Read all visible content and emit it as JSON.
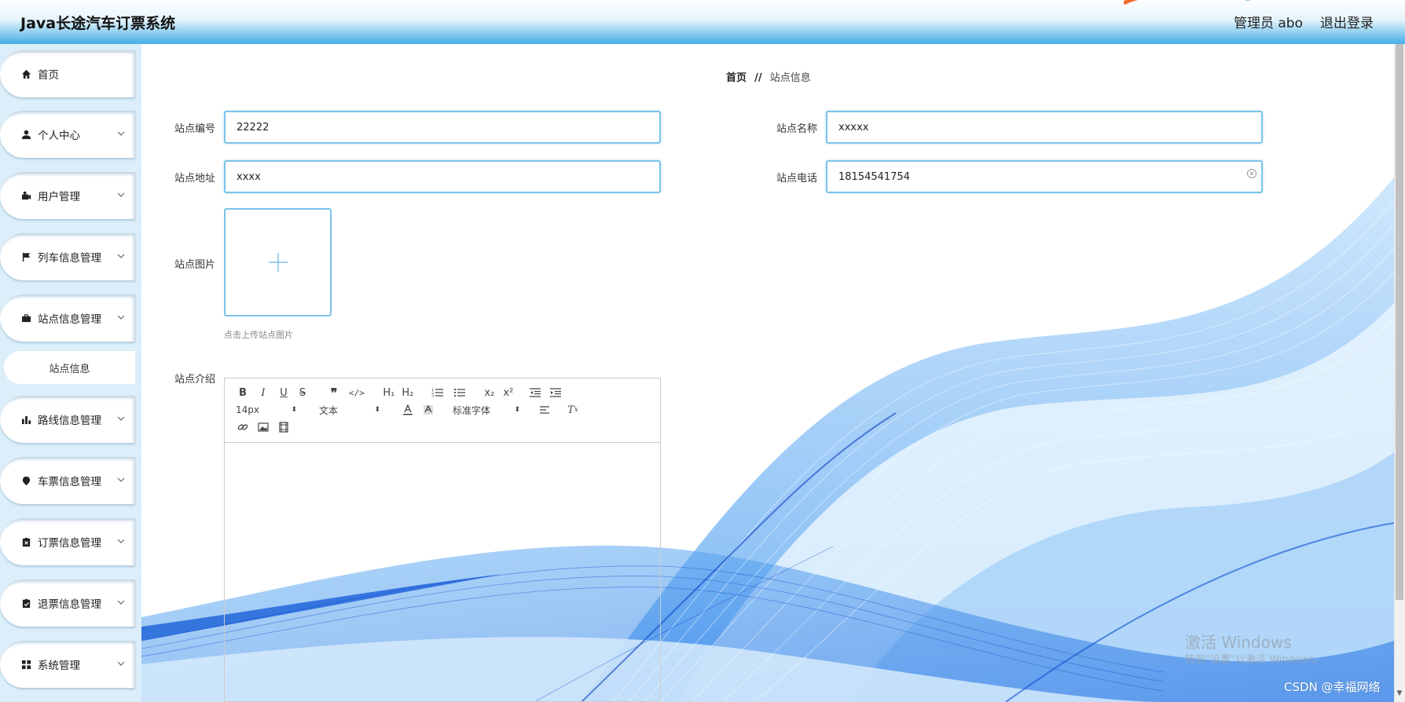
{
  "header": {
    "app_title": "Java长途汽车订票系统",
    "user_label": "管理员 abo",
    "logout_label": "退出登录"
  },
  "sidebar": {
    "items": [
      {
        "label": "首页",
        "icon": "home-icon",
        "has_chevron": false
      },
      {
        "label": "个人中心",
        "icon": "user-icon",
        "has_chevron": true
      },
      {
        "label": "用户管理",
        "icon": "user-manage-icon",
        "has_chevron": true
      },
      {
        "label": "列车信息管理",
        "icon": "flag-icon",
        "has_chevron": true
      },
      {
        "label": "站点信息管理",
        "icon": "briefcase-icon",
        "has_chevron": true
      },
      {
        "label": "路线信息管理",
        "icon": "bar-chart-icon",
        "has_chevron": true
      },
      {
        "label": "车票信息管理",
        "icon": "map-pin-icon",
        "has_chevron": true
      },
      {
        "label": "订票信息管理",
        "icon": "clipboard-icon",
        "has_chevron": true
      },
      {
        "label": "退票信息管理",
        "icon": "clipboard-check-icon",
        "has_chevron": true
      },
      {
        "label": "系统管理",
        "icon": "grid-icon",
        "has_chevron": true
      }
    ],
    "sub_item": "站点信息"
  },
  "breadcrumb": {
    "home": "首页",
    "separator": "//",
    "current": "站点信息"
  },
  "form": {
    "station_code_label": "站点编号",
    "station_code_value": "22222",
    "station_name_label": "站点名称",
    "station_name_value": "xxxxx",
    "station_address_label": "站点地址",
    "station_address_value": "xxxx",
    "station_phone_label": "站点电话",
    "station_phone_value": "18154541754",
    "station_image_label": "站点图片",
    "upload_tip": "点击上传站点图片",
    "station_intro_label": "站点介绍"
  },
  "editor": {
    "font_size": "14px",
    "heading": "文本",
    "font_family": "标准字体"
  },
  "watermark": {
    "line1": "激活 Windows",
    "line2": "转到\"设置\"以激活 Windows。",
    "csdn": "CSDN @幸福网络"
  },
  "colors": {
    "accent": "#45aee8",
    "input_border": "#7cc3e8",
    "sidebar_bg": "#dbeefa",
    "wave": "#1e88e5"
  }
}
